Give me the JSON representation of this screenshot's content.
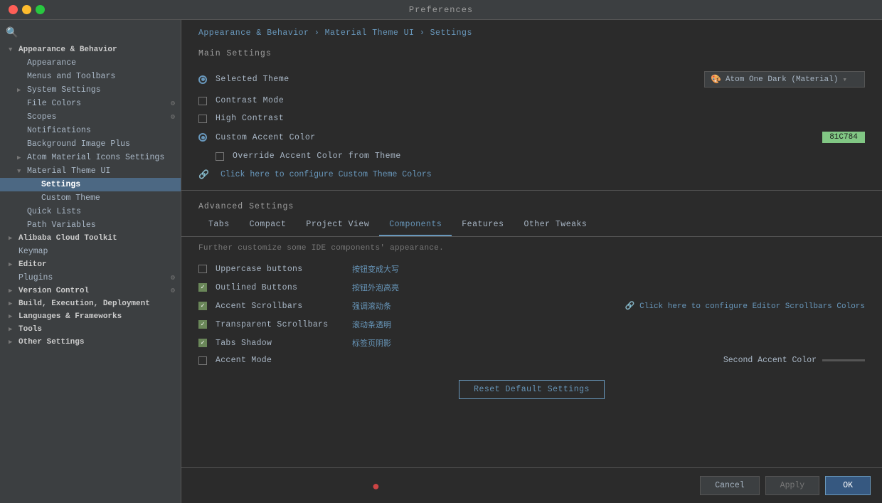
{
  "titleBar": {
    "title": "Preferences"
  },
  "sidebar": {
    "searchPlaceholder": "Search",
    "items": [
      {
        "id": "appearance-behavior",
        "label": "Appearance & Behavior",
        "level": 0,
        "expanded": true,
        "arrow": "▼",
        "state": "section"
      },
      {
        "id": "appearance",
        "label": "Appearance",
        "level": 1,
        "state": "normal"
      },
      {
        "id": "menus-toolbars",
        "label": "Menus and Toolbars",
        "level": 1,
        "state": "normal"
      },
      {
        "id": "system-settings",
        "label": "System Settings",
        "level": 1,
        "arrow": "▶",
        "state": "normal"
      },
      {
        "id": "file-colors",
        "label": "File Colors",
        "level": 1,
        "badge": "⚙",
        "state": "normal"
      },
      {
        "id": "scopes",
        "label": "Scopes",
        "level": 1,
        "badge": "⚙",
        "state": "normal"
      },
      {
        "id": "notifications",
        "label": "Notifications",
        "level": 1,
        "state": "normal"
      },
      {
        "id": "background-image-plus",
        "label": "Background Image Plus",
        "level": 1,
        "state": "normal"
      },
      {
        "id": "atom-material-icons",
        "label": "Atom Material Icons Settings",
        "level": 1,
        "arrow": "▶",
        "state": "normal"
      },
      {
        "id": "material-theme-ui",
        "label": "Material Theme UI",
        "level": 1,
        "arrow": "▼",
        "expanded": true,
        "state": "normal"
      },
      {
        "id": "settings",
        "label": "Settings",
        "level": 2,
        "state": "active"
      },
      {
        "id": "custom-theme",
        "label": "Custom Theme",
        "level": 2,
        "state": "normal"
      },
      {
        "id": "quick-lists",
        "label": "Quick Lists",
        "level": 1,
        "state": "normal"
      },
      {
        "id": "path-variables",
        "label": "Path Variables",
        "level": 1,
        "state": "normal"
      },
      {
        "id": "alibaba-cloud-toolkit",
        "label": "Alibaba Cloud Toolkit",
        "level": 0,
        "arrow": "▶",
        "state": "section"
      },
      {
        "id": "keymap",
        "label": "Keymap",
        "level": 0,
        "state": "normal"
      },
      {
        "id": "editor",
        "label": "Editor",
        "level": 0,
        "arrow": "▶",
        "state": "section"
      },
      {
        "id": "plugins",
        "label": "Plugins",
        "level": 0,
        "badge": "⚙",
        "state": "normal"
      },
      {
        "id": "version-control",
        "label": "Version Control",
        "level": 0,
        "arrow": "▶",
        "badge": "⚙",
        "state": "section"
      },
      {
        "id": "build-execution-deployment",
        "label": "Build, Execution, Deployment",
        "level": 0,
        "arrow": "▶",
        "state": "section"
      },
      {
        "id": "languages-frameworks",
        "label": "Languages & Frameworks",
        "level": 0,
        "arrow": "▶",
        "state": "section"
      },
      {
        "id": "tools",
        "label": "Tools",
        "level": 0,
        "arrow": "▶",
        "state": "section"
      },
      {
        "id": "other-settings",
        "label": "Other Settings",
        "level": 0,
        "arrow": "▶",
        "state": "section"
      }
    ]
  },
  "breadcrumb": {
    "parts": [
      "Appearance & Behavior",
      "Material Theme UI",
      "Settings"
    ],
    "separator": "›",
    "text": "Appearance & Behavior  ›  Material Theme UI  ›  Settings"
  },
  "mainSettings": {
    "title": "Main Settings",
    "selectedTheme": {
      "label": "Selected Theme",
      "value": "Atom One Dark (Material)",
      "icon": "🎨"
    },
    "contrastMode": {
      "label": "Contrast Mode",
      "checked": false
    },
    "highContrast": {
      "label": "High Contrast",
      "checked": false
    },
    "customAccentColor": {
      "label": "Custom Accent Color",
      "colorValue": "81C784",
      "colorBg": "#81c784"
    },
    "overrideAccentColor": {
      "label": "Override Accent Color from Theme",
      "checked": false
    },
    "configureLink": "Click here to configure Custom Theme Colors"
  },
  "advancedSettings": {
    "title": "Advanced Settings",
    "tabs": [
      {
        "id": "tabs",
        "label": "Tabs",
        "active": false
      },
      {
        "id": "compact",
        "label": "Compact",
        "active": false
      },
      {
        "id": "project-view",
        "label": "Project View",
        "active": false
      },
      {
        "id": "components",
        "label": "Components",
        "active": true
      },
      {
        "id": "features",
        "label": "Features",
        "active": false
      },
      {
        "id": "other-tweaks",
        "label": "Other Tweaks",
        "active": false
      }
    ],
    "tabDescription": "Further customize some IDE components' appearance.",
    "components": [
      {
        "id": "uppercase-buttons",
        "label": "Uppercase buttons",
        "checked": false,
        "desc": "按钮变成大写",
        "extraLink": null
      },
      {
        "id": "outlined-buttons",
        "label": "Outlined Buttons",
        "checked": true,
        "desc": "按钮外泡高亮",
        "extraLink": null
      },
      {
        "id": "accent-scrollbars",
        "label": "Accent Scrollbars",
        "checked": true,
        "desc": "强调滚动条",
        "extraLink": "Click here to configure Editor Scrollbars Colors"
      },
      {
        "id": "transparent-scrollbars",
        "label": "Transparent Scrollbars",
        "checked": true,
        "desc": "滚动条透明",
        "extraLink": null
      },
      {
        "id": "tabs-shadow",
        "label": "Tabs Shadow",
        "checked": true,
        "desc": "标签页阴影",
        "extraLink": null
      },
      {
        "id": "accent-mode",
        "label": "Accent Mode",
        "checked": false,
        "desc": null,
        "secondAccent": "Second Accent Color"
      }
    ]
  },
  "buttons": {
    "resetDefault": "Reset Default Settings",
    "cancel": "Cancel",
    "apply": "Apply",
    "ok": "OK"
  }
}
